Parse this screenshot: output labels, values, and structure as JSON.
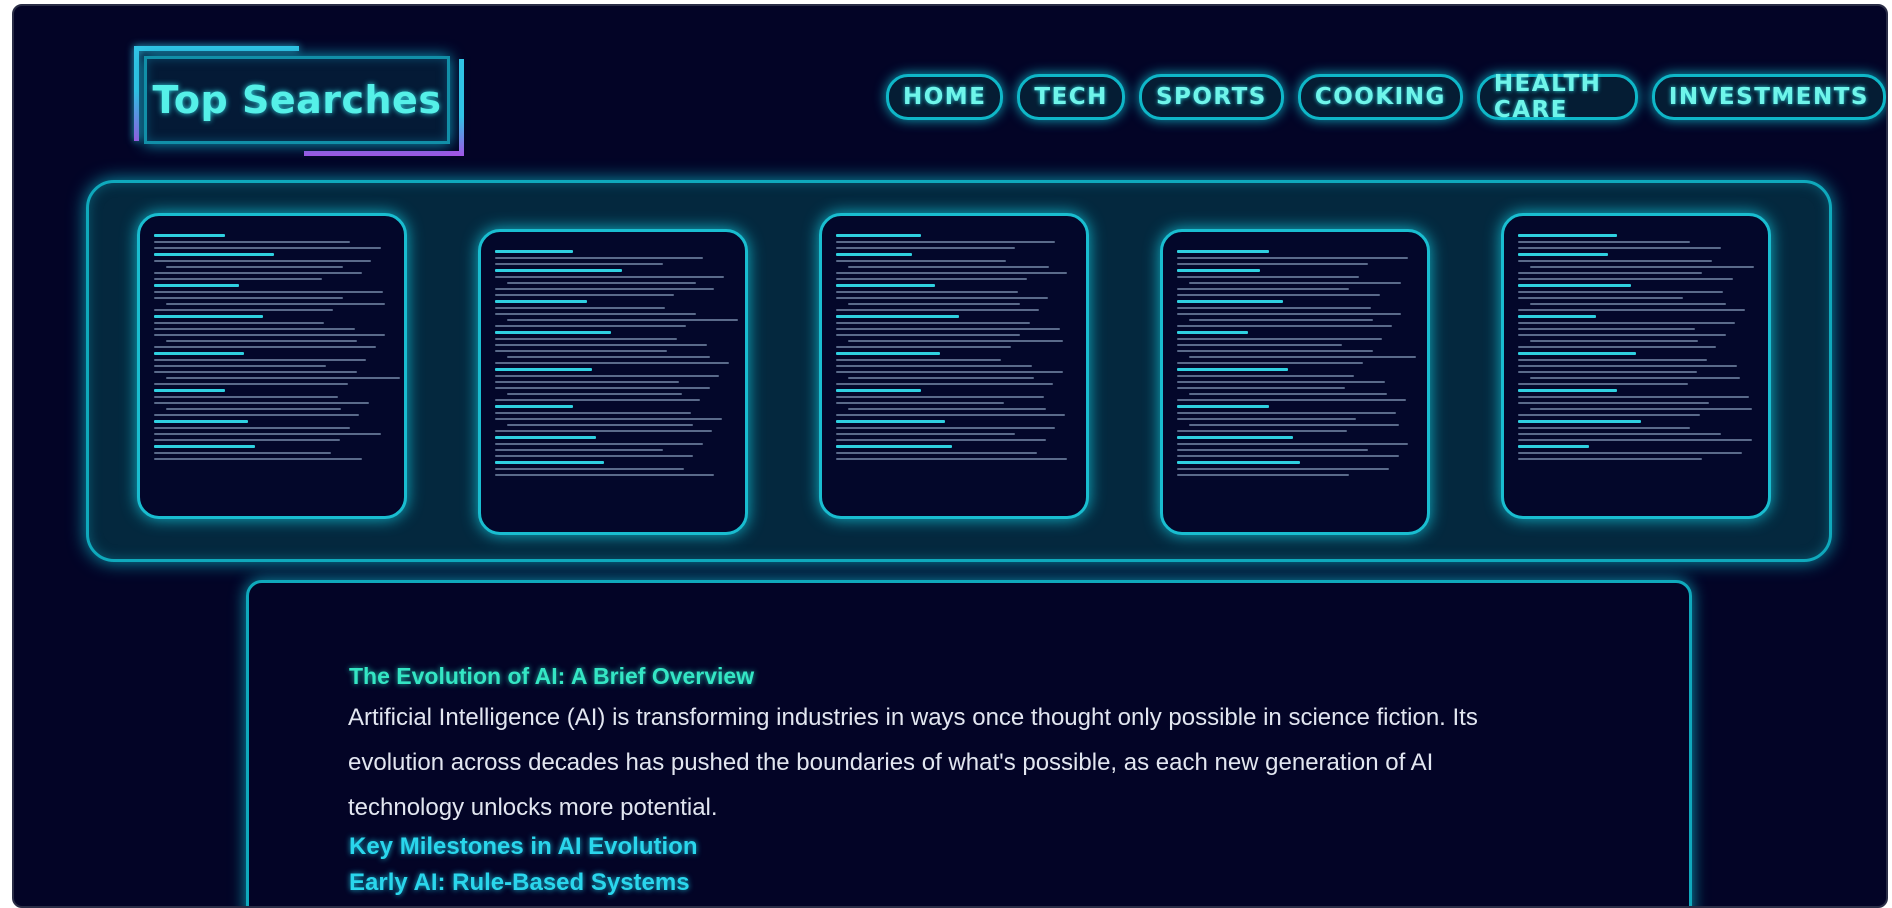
{
  "logo": {
    "text": "Top Searches"
  },
  "nav": {
    "items": [
      {
        "label": "HOME"
      },
      {
        "label": "TECH"
      },
      {
        "label": "SPORTS"
      },
      {
        "label": "COOKING"
      },
      {
        "label": "HEALTH CARE"
      },
      {
        "label": "INVESTMENTS"
      }
    ]
  },
  "carousel": {
    "cards": [
      {
        "topic": "ai-evolution"
      },
      {
        "topic": "career-development"
      },
      {
        "topic": "technology-trends"
      },
      {
        "topic": "self-improvement"
      },
      {
        "topic": "lifestyle-balance"
      }
    ]
  },
  "article": {
    "title": "The Evolution of AI: A Brief Overview",
    "body": "Artificial Intelligence (AI) is transforming industries in ways once thought only possible in science fiction. Its evolution across decades has pushed the boundaries of what's possible, as each new generation of AI technology unlocks more potential.",
    "heading_milestones": "Key Milestones in AI Evolution",
    "heading_early": "Early AI: Rule-Based Systems"
  },
  "colors": {
    "background": "#030426",
    "accent": "#0fb7c8",
    "nav_text": "#6ff5ea",
    "title_green": "#34e6c4"
  }
}
